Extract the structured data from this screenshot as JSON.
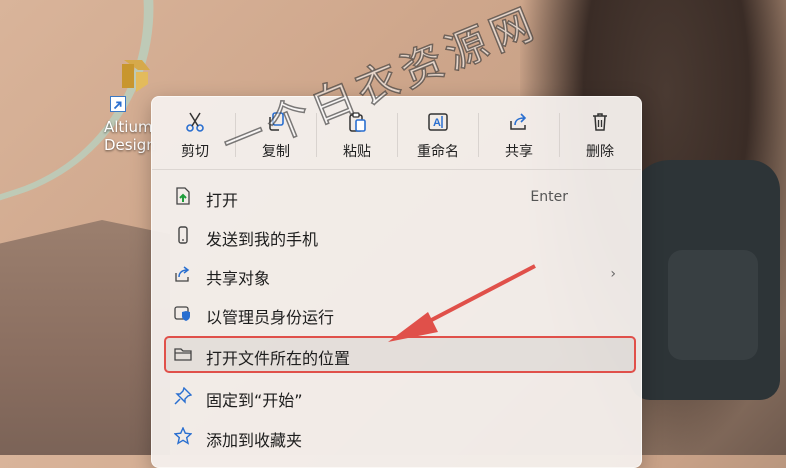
{
  "desktop": {
    "icon_label": "Altium\nDesign",
    "icon_name": "altium-designer-icon"
  },
  "toolbar": {
    "cut": "剪切",
    "copy": "复制",
    "paste": "粘贴",
    "rename": "重命名",
    "share": "共享",
    "delete": "删除"
  },
  "menu": {
    "items": [
      {
        "label": "打开",
        "accelerator": "Enter",
        "icon": "open-file-icon"
      },
      {
        "label": "发送到我的手机",
        "icon": "phone-icon"
      },
      {
        "label": "共享对象",
        "submenu": "›",
        "icon": "share-icon"
      },
      {
        "label": "以管理员身份运行",
        "icon": "shield-icon"
      },
      {
        "label": "打开文件所在的位置",
        "icon": "folder-icon"
      },
      {
        "label": "固定到“开始”",
        "icon": "pin-icon"
      },
      {
        "label": "添加到收藏夹",
        "icon": "star-icon"
      }
    ]
  },
  "watermark": "一个白衣资源网",
  "colors": {
    "accent": "#2a6fd0",
    "annotation": "#e0504a"
  }
}
